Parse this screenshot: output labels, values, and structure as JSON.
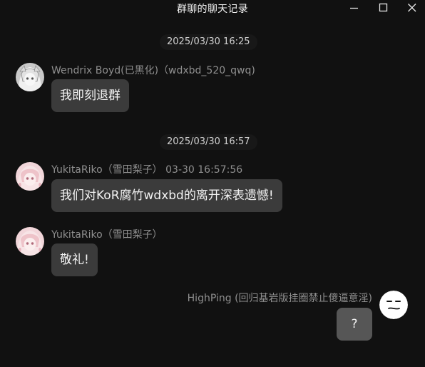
{
  "window": {
    "title": "群聊的聊天记录"
  },
  "messages": [
    {
      "timestamp": "2025/03/30 16:25",
      "sender": "Wendrix Boyd(已黑化)（wdxbd_520_qwq)",
      "text": "我即刻退群"
    },
    {
      "timestamp": "2025/03/30 16:57",
      "sender": "YukitaRiko（雪田梨子） 03-30 16:57:56",
      "text": "我们对KoR腐竹wdxbd的离开深表遗憾!"
    },
    {
      "sender": "YukitaRiko（雪田梨子）",
      "text": "敬礼!"
    },
    {
      "sender": "HighPing (回归基岩版挂圈禁止傻逼意淫)",
      "text": "?"
    }
  ],
  "colors": {
    "background": "#111111",
    "bubble": "#3b3b3b",
    "bubble_self": "#565656",
    "sender_text": "#8f8f8f"
  },
  "icons": {
    "minimize": "minimize-icon",
    "maximize": "maximize-icon",
    "close": "close-icon"
  }
}
